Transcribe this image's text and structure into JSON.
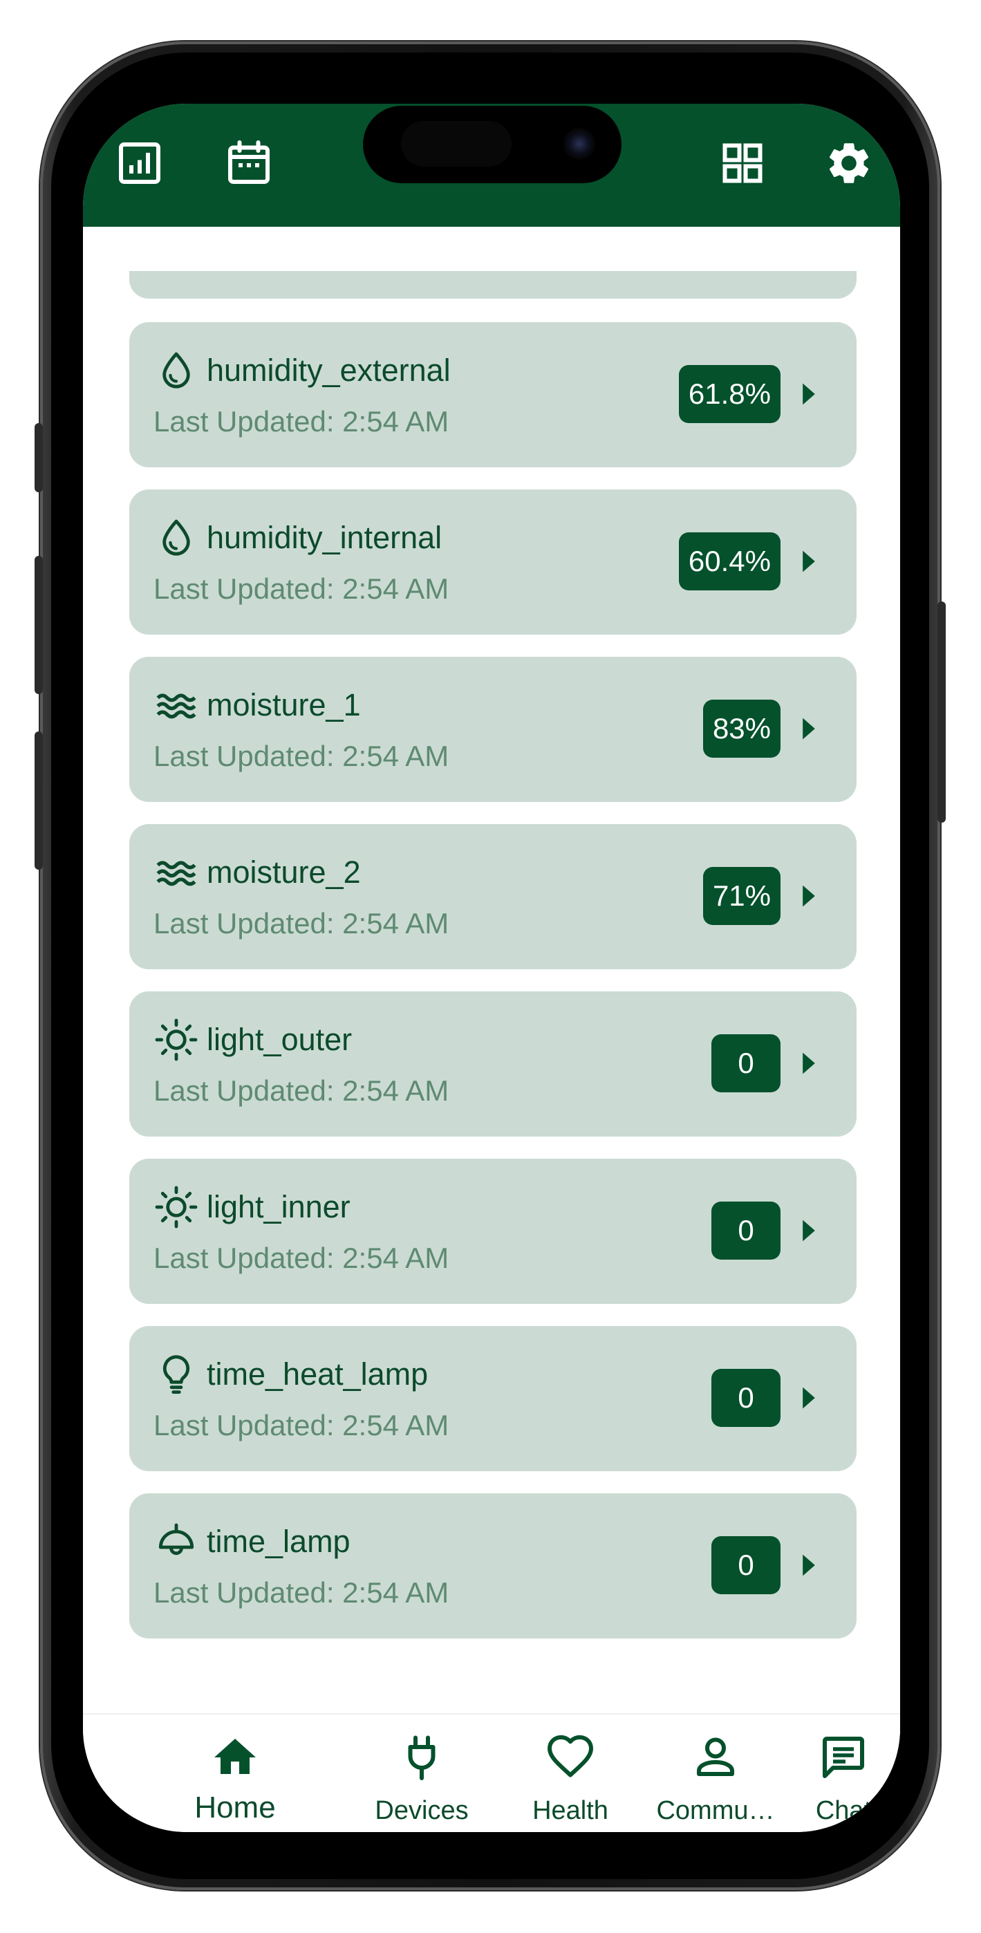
{
  "colors": {
    "primary": "#04512c",
    "card_bg": "#cbdbd3",
    "text_primary": "#0c4a2c",
    "text_secondary": "#5f8a72",
    "value_text": "#ffffff"
  },
  "header": {
    "icons": [
      "chart-icon",
      "calendar-icon",
      "grid-icon",
      "settings-icon"
    ]
  },
  "sensors": [
    {
      "icon": "water-drop-icon",
      "name": "humidity_external",
      "updated": "Last Updated: 2:54 AM",
      "value": "61.8%"
    },
    {
      "icon": "water-drop-icon",
      "name": "humidity_internal",
      "updated": "Last Updated: 2:54 AM",
      "value": "60.4%"
    },
    {
      "icon": "waves-icon",
      "name": "moisture_1",
      "updated": "Last Updated: 2:54 AM",
      "value": "83%"
    },
    {
      "icon": "waves-icon",
      "name": "moisture_2",
      "updated": "Last Updated: 2:54 AM",
      "value": "71%"
    },
    {
      "icon": "sun-icon",
      "name": "light_outer",
      "updated": "Last Updated: 2:54 AM",
      "value": "0"
    },
    {
      "icon": "sun-icon",
      "name": "light_inner",
      "updated": "Last Updated: 2:54 AM",
      "value": "0"
    },
    {
      "icon": "lightbulb-icon",
      "name": "time_heat_lamp",
      "updated": "Last Updated: 2:54 AM",
      "value": "0"
    },
    {
      "icon": "ceiling-lamp-icon",
      "name": "time_lamp",
      "updated": "Last Updated: 2:54 AM",
      "value": "0"
    }
  ],
  "bottom_nav": {
    "items": [
      {
        "label": "Home",
        "icon": "home-icon",
        "active": true
      },
      {
        "label": "Devices",
        "icon": "plug-icon",
        "active": false
      },
      {
        "label": "Health",
        "icon": "heart-icon",
        "active": false
      },
      {
        "label": "Commu…",
        "icon": "person-icon",
        "active": false
      },
      {
        "label": "Chat",
        "icon": "chat-icon",
        "active": false
      }
    ]
  }
}
